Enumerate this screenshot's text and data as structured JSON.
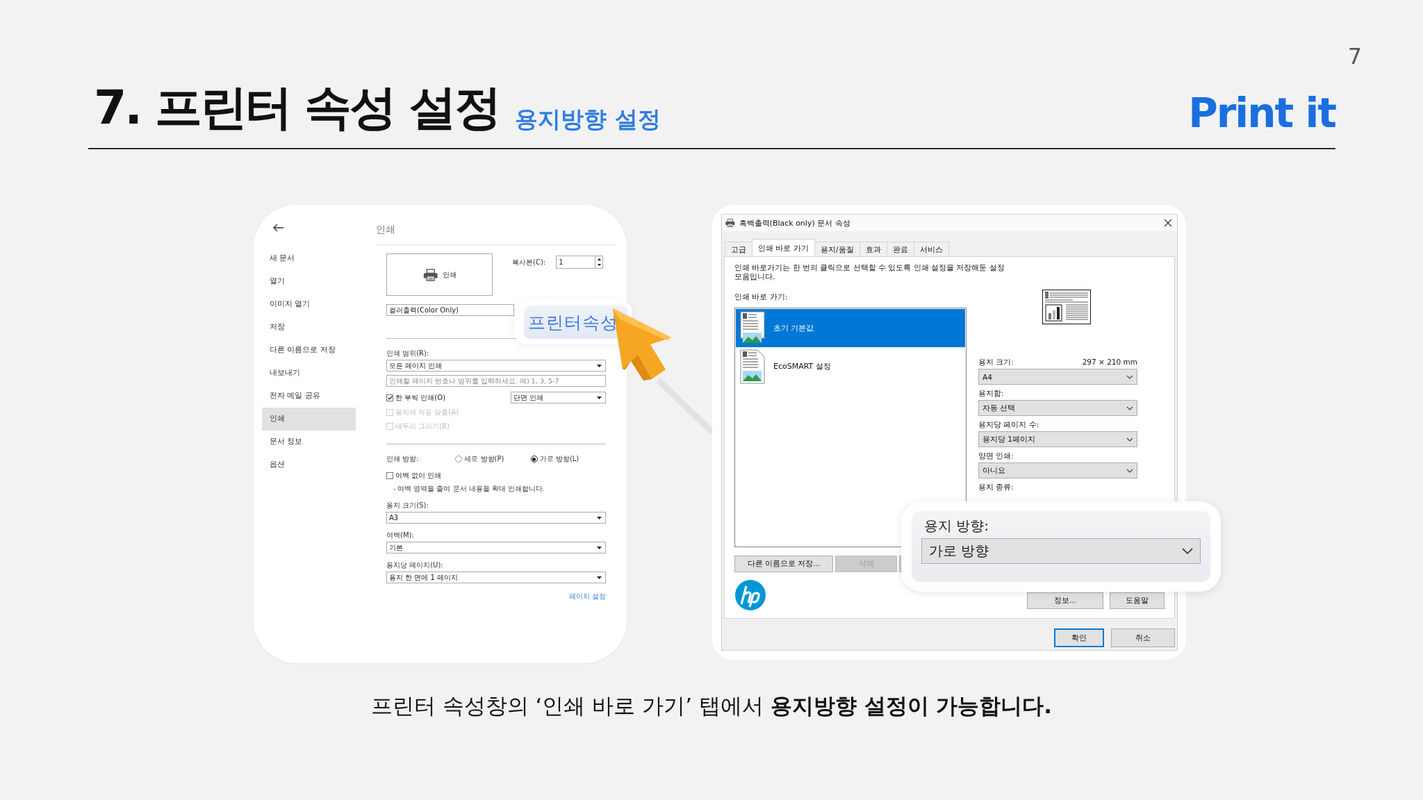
{
  "slide": {
    "page_number": "7",
    "title": "7. 프린터 속성 설정",
    "subtitle": "용지방향 설정",
    "brand": "Print it",
    "caption": "프린터 속성창의 ‘인쇄 바로 가기’ 탭에서 **용지방향 설정이 가능합니다.**"
  },
  "print_panel": {
    "heading": "인쇄",
    "menu": [
      {
        "label": "새 문서",
        "selected": false
      },
      {
        "label": "열기",
        "selected": false
      },
      {
        "label": "이미지 열기",
        "selected": false
      },
      {
        "label": "저장",
        "selected": false
      },
      {
        "label": "다른 이름으로 저장",
        "selected": false
      },
      {
        "label": "내보내기",
        "selected": false
      },
      {
        "label": "전자 메일 공유",
        "selected": false
      },
      {
        "label": "인쇄",
        "selected": true
      },
      {
        "label": "문서 정보",
        "selected": false
      },
      {
        "label": "옵션",
        "selected": false
      }
    ],
    "print_button": "인쇄",
    "copies_label": "복사본(C):",
    "copies_value": "1",
    "printer": "컬러출력(Color Only)",
    "range_label": "인쇄 범위(R):",
    "range_value": "모든 페이지 인쇄",
    "pages_placeholder": "인쇄할 페이지 번호나 범위를 입력하세요. 예) 1, 3, 5-7",
    "options": [
      {
        "label": "한 부씩 인쇄(O)",
        "checked": true,
        "disabled": false
      },
      {
        "label": "용지에 자동 맞춤(A)",
        "checked": false,
        "disabled": true
      },
      {
        "label": "테두리 그리기(B)",
        "checked": false,
        "disabled": true
      }
    ],
    "duplex": "단면 인쇄",
    "orientation_label": "인쇄 방향:",
    "orientations": [
      {
        "label": "세로 방향(P)",
        "selected": false
      },
      {
        "label": "가로 방향(L)",
        "selected": true
      }
    ],
    "borderless": {
      "label": "여백 없이 인쇄",
      "checked": false
    },
    "borderless_note": "- 여백 영역을 줄여 문서 내용을 확대 인쇄합니다.",
    "fields": [
      {
        "label": "용지 크기(S):",
        "value": "A3"
      },
      {
        "label": "여백(M):",
        "value": "기본"
      },
      {
        "label": "용지당 페이지(U):",
        "value": "용지 한 면에 1 페이지"
      }
    ],
    "page_setup_link": "페이지 설정"
  },
  "properties_dialog": {
    "title": "흑백출력(Black only) 문서 속성",
    "tabs": [
      {
        "label": "고급",
        "selected": false
      },
      {
        "label": "인쇄 바로 가기",
        "selected": true
      },
      {
        "label": "용지/품질",
        "selected": false
      },
      {
        "label": "효과",
        "selected": false
      },
      {
        "label": "완료",
        "selected": false
      },
      {
        "label": "서비스",
        "selected": false
      }
    ],
    "description": "인쇄 바로가기는 한 번의 클릭으로 선택할 수 있도록 인쇄 설정을 저장해둔 설정 모음입니다.",
    "shortcuts_label": "인쇄 바로 가기:",
    "shortcuts": [
      {
        "label": "초기 기본값",
        "selected": true
      },
      {
        "label": "EcoSMART 설정",
        "selected": false
      }
    ],
    "settings": [
      {
        "label": "용지 크기:",
        "note": "297 × 210 mm",
        "value": "A4"
      },
      {
        "label": "용지함:",
        "value": "자동 선택"
      },
      {
        "label": "용지당 페이지 수:",
        "value": "용지당 1페이지"
      },
      {
        "label": "양면 인쇄:",
        "value": "아니요"
      }
    ],
    "partial_label": "용지 종류:",
    "list_buttons": [
      {
        "label": "다른 이름으로 저장...",
        "disabled": false
      },
      {
        "label": "삭제",
        "disabled": true
      }
    ],
    "info_buttons": [
      "정보...",
      "도움말"
    ],
    "footer_buttons": [
      {
        "label": "확인",
        "focused": true
      },
      {
        "label": "취소",
        "focused": false
      }
    ]
  },
  "callouts": {
    "printer_properties": "프린터속성",
    "orientation": {
      "label": "용지 방향:",
      "value": "가로 방향"
    }
  }
}
